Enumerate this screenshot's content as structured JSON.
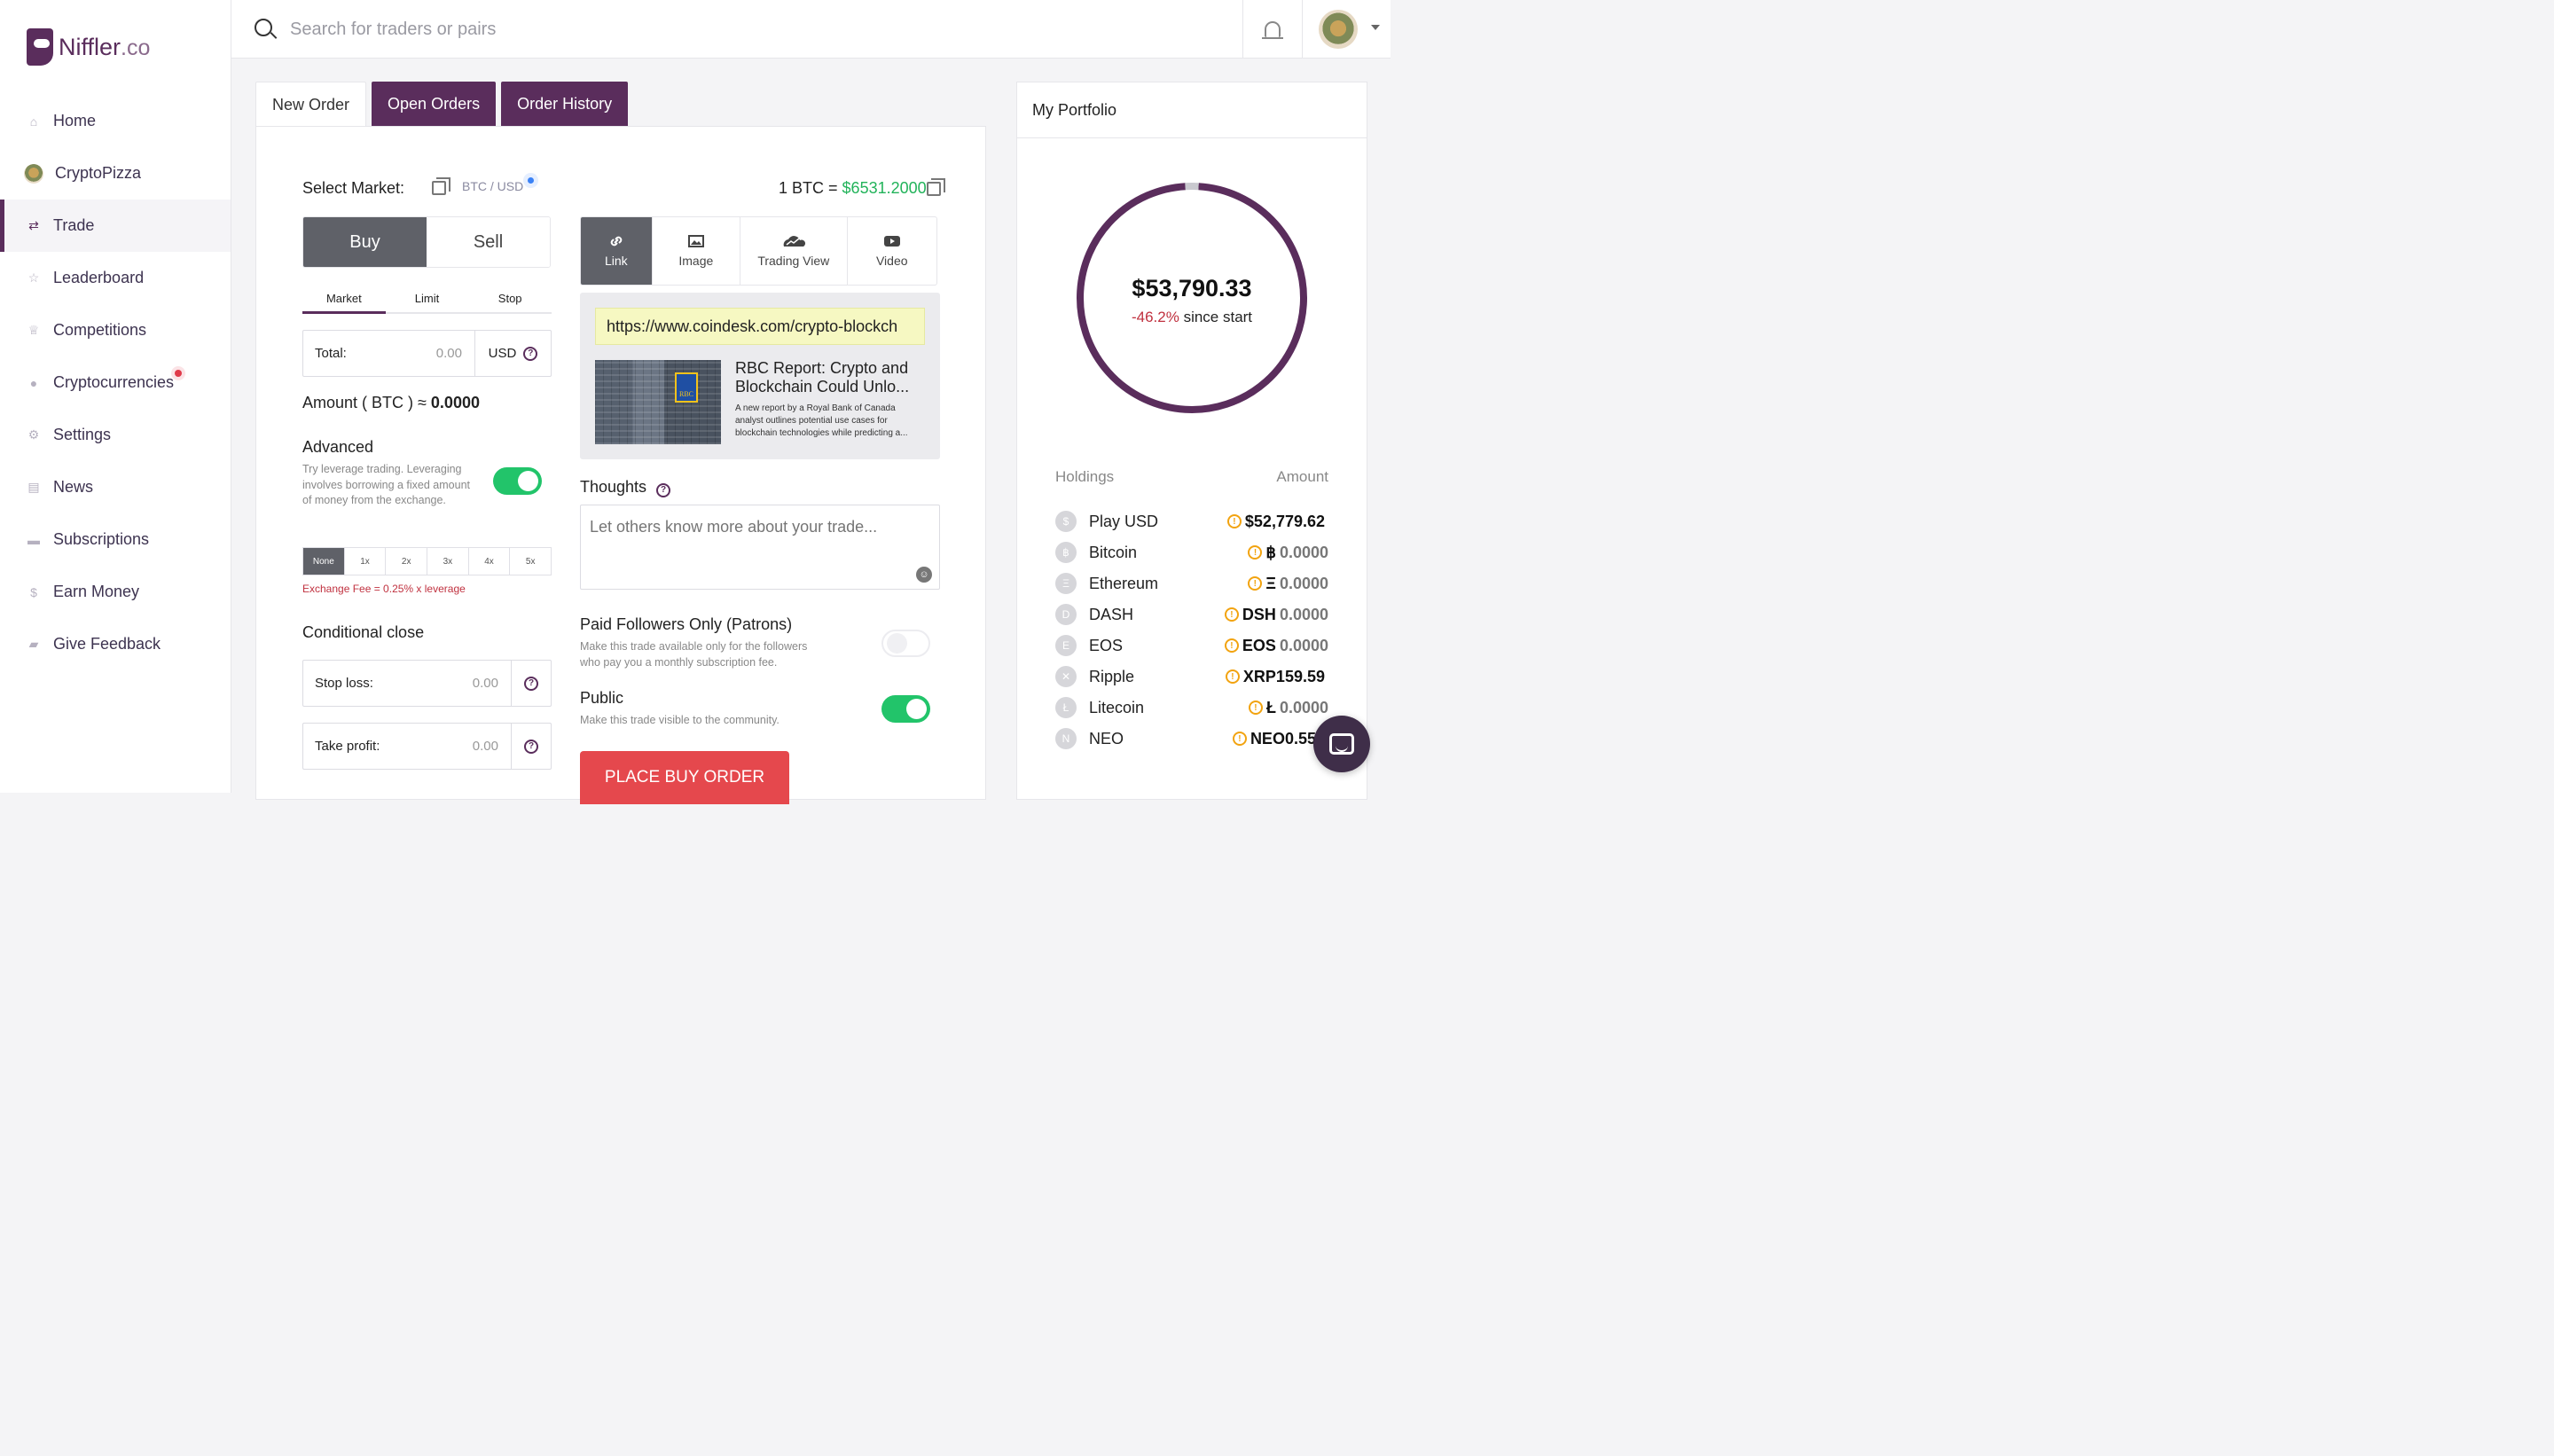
{
  "brand": {
    "name": "Niffler",
    "suffix": ".co"
  },
  "sidebar": {
    "items": [
      {
        "label": "Home",
        "icon": "home-icon"
      },
      {
        "label": "CryptoPizza",
        "icon": "avatar"
      },
      {
        "label": "Trade",
        "icon": "swap-arrows-icon",
        "active": true
      },
      {
        "label": "Leaderboard",
        "icon": "star-icon"
      },
      {
        "label": "Competitions",
        "icon": "trophy-icon"
      },
      {
        "label": "Cryptocurrencies",
        "icon": "coin-icon",
        "notification": true
      },
      {
        "label": "Settings",
        "icon": "gear-icon"
      },
      {
        "label": "News",
        "icon": "newspaper-icon"
      },
      {
        "label": "Subscriptions",
        "icon": "card-icon"
      },
      {
        "label": "Earn Money",
        "icon": "dollar-icon"
      },
      {
        "label": "Give Feedback",
        "icon": "chat-bubble-icon"
      }
    ]
  },
  "search": {
    "placeholder": "Search for traders or pairs"
  },
  "tabs": [
    {
      "label": "New Order",
      "active": true
    },
    {
      "label": "Open Orders"
    },
    {
      "label": "Order History"
    }
  ],
  "order": {
    "select_market_label": "Select Market:",
    "pair_base": "BTC",
    "pair_sep": "/",
    "pair_quote": "USD",
    "rate_prefix": "1 BTC =",
    "rate_value": "$6531.2000",
    "buy_label": "Buy",
    "sell_label": "Sell",
    "order_types": [
      "Market",
      "Limit",
      "Stop"
    ],
    "selected_order_type": "Market",
    "total_label": "Total:",
    "total_value": "0.00",
    "total_unit": "USD",
    "amount_label": "Amount ( BTC ) ≈",
    "amount_value": "0.0000",
    "advanced_title": "Advanced",
    "advanced_desc": "Try leverage trading. Leveraging involves borrowing a fixed amount of money from the exchange.",
    "advanced_enabled": true,
    "leverage_options": [
      "None",
      "1x",
      "2x",
      "3x",
      "4x",
      "5x"
    ],
    "selected_leverage": "None",
    "fee_text": "Exchange Fee = 0.25% x leverage",
    "conditional_title": "Conditional close",
    "stop_loss_label": "Stop loss:",
    "stop_loss_value": "0.00",
    "take_profit_label": "Take profit:",
    "take_profit_value": "0.00"
  },
  "media": {
    "tabs": [
      {
        "label": "Link",
        "icon": "link-icon",
        "active": true
      },
      {
        "label": "Image",
        "icon": "image-icon"
      },
      {
        "label": "Trading View",
        "icon": "chart-cloud-icon"
      },
      {
        "label": "Video",
        "icon": "play-icon"
      }
    ],
    "url": "https://www.coindesk.com/crypto-blockch",
    "article_title": "RBC Report: Crypto and Blockchain Could Unlo...",
    "article_desc": "A new report by a Royal Bank of Canada analyst outlines potential use cases for blockchain technologies while predicting a...",
    "thumb_logo": "RBC"
  },
  "thoughts": {
    "label": "Thoughts",
    "placeholder": "Let others know more about your trade..."
  },
  "paid": {
    "title": "Paid Followers Only (Patrons)",
    "desc": "Make this trade available only for the followers who pay you a monthly subscription fee.",
    "enabled": false
  },
  "public": {
    "title": "Public",
    "desc": "Make this trade visible to the community.",
    "enabled": true
  },
  "place_order_label": "PLACE BUY ORDER",
  "portfolio": {
    "title": "My Portfolio",
    "total": "$53,790.33",
    "change": "-46.2%",
    "change_suffix": "since start",
    "holdings_label": "Holdings",
    "amount_label": "Amount",
    "holdings": [
      {
        "name": "Play USD",
        "symbol": "$",
        "amount_strong": "$52,779.62",
        "amount_muted": ""
      },
      {
        "name": "Bitcoin",
        "symbol": "฿",
        "amount_strong": "฿",
        "amount_muted": "0.0000"
      },
      {
        "name": "Ethereum",
        "symbol": "Ξ",
        "amount_strong": "Ξ",
        "amount_muted": "0.0000"
      },
      {
        "name": "DASH",
        "symbol": "D",
        "amount_strong": "DSH",
        "amount_muted": "0.0000"
      },
      {
        "name": "EOS",
        "symbol": "E",
        "amount_strong": "EOS",
        "amount_muted": "0.0000"
      },
      {
        "name": "Ripple",
        "symbol": "✕",
        "amount_strong": "XRP159.59",
        "amount_muted": ""
      },
      {
        "name": "Litecoin",
        "symbol": "Ł",
        "amount_strong": "Ł",
        "amount_muted": "0.0000"
      },
      {
        "name": "NEO",
        "symbol": "N",
        "amount_strong": "NEO0.558",
        "amount_muted": ""
      }
    ],
    "allocation": {
      "play_usd_fraction": 0.981,
      "crypto_fraction": 0.019
    },
    "colors": {
      "ring": "#5a2d5c",
      "gap": "#c9c9cf"
    }
  },
  "colors": {
    "brand": "#5a2d5c",
    "positive": "#22c46a",
    "negative": "#c0313f",
    "cta": "#e5484d"
  }
}
